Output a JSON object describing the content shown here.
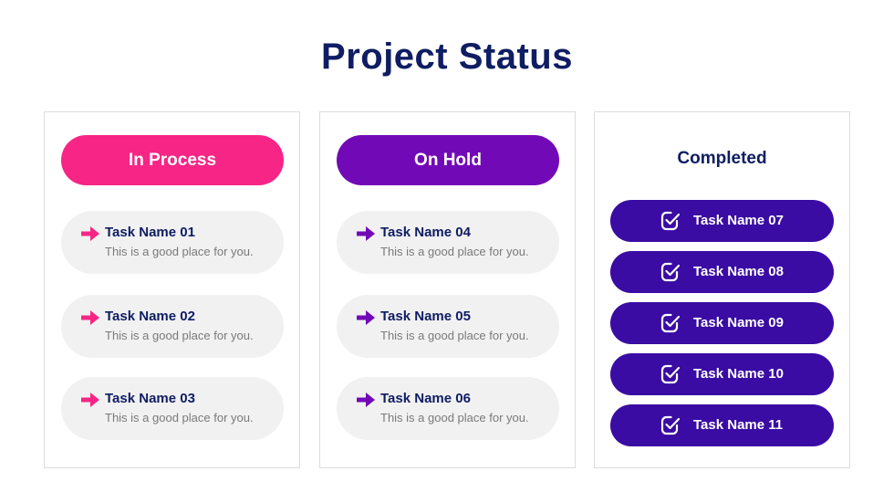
{
  "title": "Project Status",
  "colors": {
    "title": "#0f1d63",
    "in_process": "#f72585",
    "on_hold": "#7209b7",
    "completed": "#3a0ca3",
    "task_bg": "#f1f1f1"
  },
  "columns": [
    {
      "label": "In Process",
      "tasks": [
        {
          "icon": "arrow-right-icon",
          "name": "Task Name 01",
          "desc": "This is a good place for you."
        },
        {
          "icon": "arrow-right-icon",
          "name": "Task Name 02",
          "desc": "This is a good place for you."
        },
        {
          "icon": "arrow-right-icon",
          "name": "Task Name 03",
          "desc": "This is a good place for you."
        }
      ]
    },
    {
      "label": "On Hold",
      "tasks": [
        {
          "icon": "arrow-right-icon",
          "name": "Task Name 04",
          "desc": "This is a good place for you."
        },
        {
          "icon": "arrow-right-icon",
          "name": "Task Name 05",
          "desc": "This is a good place for you."
        },
        {
          "icon": "arrow-right-icon",
          "name": "Task Name 06",
          "desc": "This is a good place for you."
        }
      ]
    },
    {
      "label": "Completed",
      "tasks": [
        {
          "icon": "checkbox-checked-icon",
          "name": "Task Name 07"
        },
        {
          "icon": "checkbox-checked-icon",
          "name": "Task Name 08"
        },
        {
          "icon": "checkbox-checked-icon",
          "name": "Task Name 09"
        },
        {
          "icon": "checkbox-checked-icon",
          "name": "Task Name 10"
        },
        {
          "icon": "checkbox-checked-icon",
          "name": "Task Name 11"
        }
      ]
    }
  ]
}
